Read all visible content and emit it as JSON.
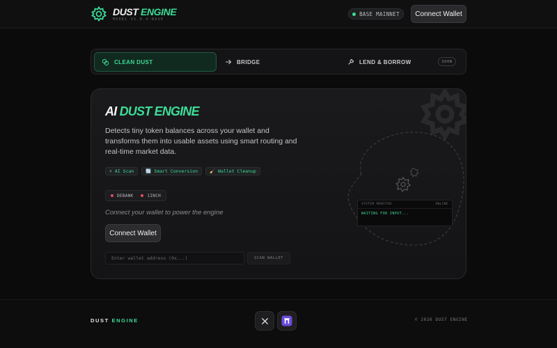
{
  "header": {
    "logo_title_part1": "DUST",
    "logo_title_part2": "ENGINE",
    "logo_subtitle": "MODEL V1.0.4-BASE",
    "network_label": "BASE MAINNET",
    "connect_label": "Connect Wallet",
    "accent_color": "#3ddc97"
  },
  "tabs": [
    {
      "label": "CLEAN DUST",
      "icon": "coins-icon",
      "active": true
    },
    {
      "label": "BRIDGE",
      "icon": "arrow-right-icon",
      "active": false
    },
    {
      "label": "LEND & BORROW",
      "icon": "wrench-icon",
      "active": false,
      "badge": "SOON"
    }
  ],
  "main": {
    "title_part1": "AI",
    "title_part2": "DUST ENGINE",
    "description": "Detects tiny token balances across your wallet and transforms them into usable assets using smart routing and real-time market data.",
    "features": [
      {
        "icon": "⚡",
        "label": "AI Scan"
      },
      {
        "icon": "🔄",
        "label": "Smart Conversion"
      },
      {
        "icon": "🧹",
        "label": "Wallet Cleanup"
      }
    ],
    "sources": [
      "DEBANK",
      "1INCH"
    ],
    "connect_hint": "Connect your wallet to power the engine",
    "connect_label": "Connect Wallet",
    "address_placeholder": "Enter wallet address (0x...)",
    "scan_label": "SCAN WALLET",
    "monitor": {
      "title": "SYSTEM MONITOR",
      "status": "ONLINE",
      "message": "WAITING FOR INPUT..."
    }
  },
  "footer": {
    "brand_part1": "DUST",
    "brand_part2": "ENGINE",
    "copyright": "© 2026 DUST ENGINE",
    "socials": [
      "x-icon",
      "farcaster-icon"
    ]
  }
}
